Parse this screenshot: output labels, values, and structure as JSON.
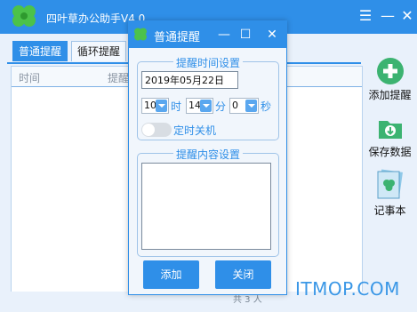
{
  "app": {
    "title": "四叶草办公助手V4.0",
    "controls": {
      "menu": "☰",
      "minimize": "—",
      "close": "✕"
    }
  },
  "tabs": [
    {
      "label": "普通提醒",
      "active": true
    },
    {
      "label": "循环提醒",
      "active": false
    }
  ],
  "grid": {
    "columns": [
      "时间",
      "提醒"
    ]
  },
  "side_buttons": [
    {
      "label": "添加提醒",
      "icon": "plus-circle-icon"
    },
    {
      "label": "保存数据",
      "icon": "folder-save-icon"
    },
    {
      "label": "记事本",
      "icon": "notebook-icon"
    }
  ],
  "status": {
    "text": "共 3 人"
  },
  "watermark": "ITMOP.COM",
  "dialog": {
    "title": "普通提醒",
    "controls": {
      "minimize": "—",
      "maximize": "☐",
      "close": "✕"
    },
    "time_group": {
      "legend": "提醒时间设置",
      "date_value": "2019年05月22日",
      "hour": "10",
      "hour_unit": "时",
      "minute": "14",
      "minute_unit": "分",
      "second": "0",
      "second_unit": "秒",
      "shutdown_label": "定时关机",
      "shutdown_enabled": false
    },
    "content_group": {
      "legend": "提醒内容设置",
      "text": ""
    },
    "buttons": {
      "add": "添加",
      "close": "关闭"
    }
  },
  "colors": {
    "primary": "#2f8fe8",
    "window_bg": "#e9f1fb",
    "accent_green": "#3cb371"
  }
}
